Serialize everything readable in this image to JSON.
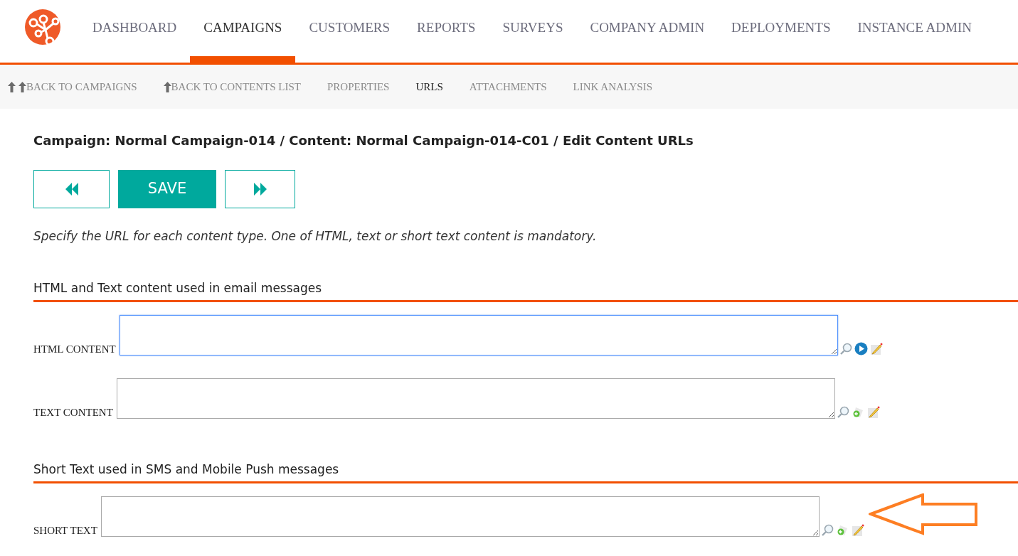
{
  "nav": [
    {
      "label": "DASHBOARD",
      "selected": false
    },
    {
      "label": "CAMPAIGNS",
      "selected": true
    },
    {
      "label": "CUSTOMERS",
      "selected": false
    },
    {
      "label": "REPORTS",
      "selected": false
    },
    {
      "label": "SURVEYS",
      "selected": false
    },
    {
      "label": "COMPANY ADMIN",
      "selected": false
    },
    {
      "label": "DEPLOYMENTS",
      "selected": false
    },
    {
      "label": "INSTANCE ADMIN",
      "selected": false
    }
  ],
  "subnav": [
    {
      "label": "BACK TO CAMPAIGNS",
      "kind": "double-up",
      "selected": false
    },
    {
      "label": "BACK TO CONTENTS LIST",
      "kind": "up",
      "selected": false
    },
    {
      "label": "PROPERTIES",
      "kind": "plain",
      "selected": false
    },
    {
      "label": "URLS",
      "kind": "plain",
      "selected": true
    },
    {
      "label": "ATTACHMENTS",
      "kind": "plain",
      "selected": false
    },
    {
      "label": "LINK ANALYSIS",
      "kind": "plain",
      "selected": false
    }
  ],
  "breadcrumb": "Campaign: Normal Campaign-014 / Content: Normal Campaign-014-C01 / Edit Content URLs",
  "buttons": [
    {
      "kind": "previous"
    },
    {
      "kind": "save",
      "label": "SAVE"
    },
    {
      "kind": "next"
    }
  ],
  "instructions": "Specify the URL for each content type. One of HTML, text or short text content is mandatory.",
  "sections": [
    {
      "title": "HTML and Text content used in email messages",
      "fields": [
        {
          "label": "HTML CONTENT",
          "focused": true,
          "tools": [
            {
              "kind": "search"
            },
            {
              "kind": "play"
            },
            {
              "kind": "edit"
            }
          ]
        },
        {
          "label": "TEXT CONTENT",
          "focused": false,
          "tools": [
            {
              "kind": "search"
            },
            {
              "kind": "convert"
            },
            {
              "kind": "edit"
            }
          ]
        }
      ]
    },
    {
      "title": "Short Text used in SMS and Mobile Push messages",
      "fields": [
        {
          "label": "SHORT TEXT",
          "focused": false,
          "tools": [
            {
              "kind": "search"
            },
            {
              "kind": "convert"
            },
            {
              "kind": "edit"
            }
          ]
        }
      ]
    }
  ]
}
